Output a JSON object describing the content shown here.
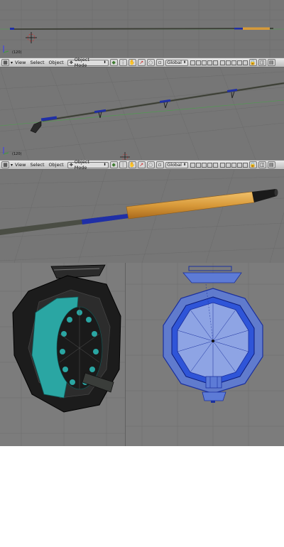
{
  "header": {
    "menus": [
      "View",
      "Select",
      "Object"
    ],
    "mode": "Object Mode",
    "orientation": "Global"
  },
  "viewports": {
    "v1": {
      "frame_label": "(120)"
    },
    "v2": {
      "frame_label": "(120)"
    }
  },
  "icons": {
    "editor_type": "grid-editor-icon",
    "menu_toggle": "triangle-toggle-icon",
    "mode": "object-mode-icon",
    "shading": "shading-sphere-icon",
    "pivot": "pivot-icon",
    "hand": "manipulator-hand-icon",
    "layers": "layer-grid-icon",
    "lock": "lock-icon",
    "render": "render-icon"
  },
  "colors": {
    "viewport_bg": "#767676",
    "header_bg": "#d2d2d2",
    "cork": "#d59a3a",
    "blank": "#4c5142",
    "winding": "#1f2fa6",
    "reel_frame": "#1c1c1c",
    "reel_spool": "#2aa6a3",
    "wire_fill": "#5d7bd6"
  }
}
